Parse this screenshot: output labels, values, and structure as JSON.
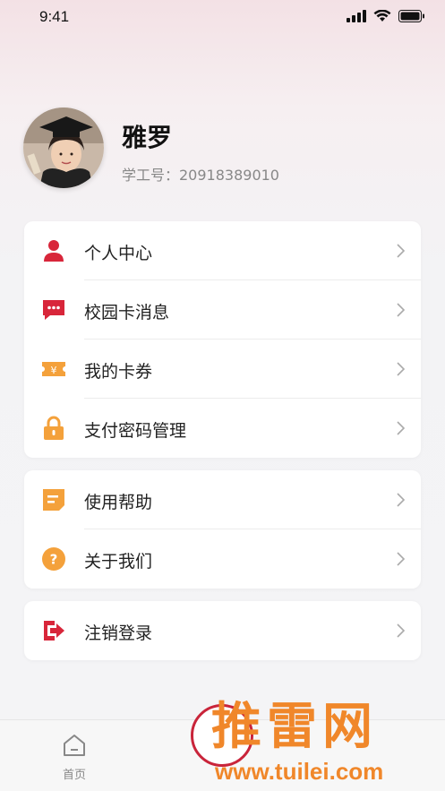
{
  "status_bar": {
    "time": "9:41"
  },
  "profile": {
    "name": "雅罗",
    "id_label": "学工号：20918389010"
  },
  "menu_groups": [
    [
      {
        "label": "个人中心",
        "icon": "user-icon",
        "color": "#d8263a"
      },
      {
        "label": "校园卡消息",
        "icon": "message-icon",
        "color": "#d8263a"
      },
      {
        "label": "我的卡券",
        "icon": "coupon-icon",
        "color": "#f4a13b"
      },
      {
        "label": "支付密码管理",
        "icon": "lock-icon",
        "color": "#f4a13b"
      }
    ],
    [
      {
        "label": "使用帮助",
        "icon": "help-doc-icon",
        "color": "#f4a13b"
      },
      {
        "label": "关于我们",
        "icon": "question-icon",
        "color": "#f4a13b"
      }
    ],
    [
      {
        "label": "注销登录",
        "icon": "logout-icon",
        "color": "#d8263a"
      }
    ]
  ],
  "tabbar": {
    "home_label": "首页"
  },
  "watermark": {
    "text": "推雷网",
    "url": "www.tuilei.com"
  }
}
